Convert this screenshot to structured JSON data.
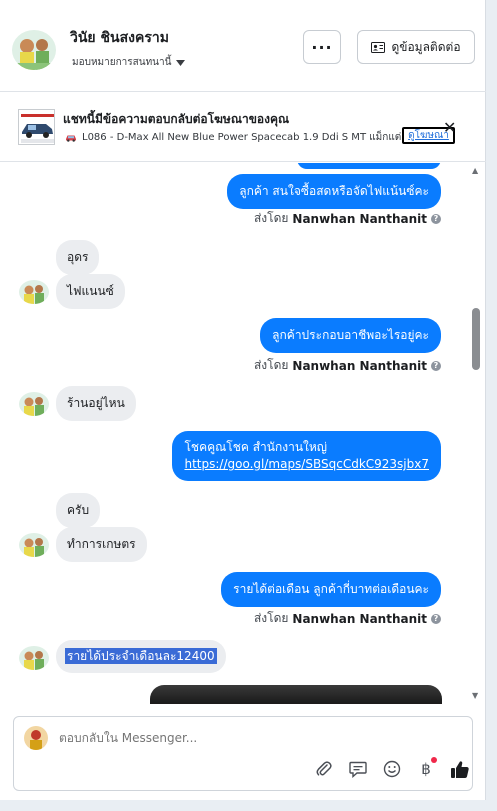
{
  "header": {
    "name": "วินัย ชินสงคราม",
    "assign_label": "มอบหมายการสนทนานี้",
    "more_label": "···",
    "contact_label": "ดูข้อมูลติดต่อ"
  },
  "banner": {
    "title": "แชทนี้มีข้อความตอบกลับต่อโฆษณาของคุณ",
    "subtitle": "L086 - D-Max All New Blue Power Spacecab 1.9 Ddi S MT แม็กแต่...",
    "link": "ดูโฆษณา",
    "close": "✕"
  },
  "messages": [
    {
      "side": "out",
      "text": "ลูกค้า สนใจซื้อสดหรือจัดไฟแน้นซ์คะ"
    },
    {
      "side": "sentby",
      "prefix": "ส่งโดย",
      "sender": "Nanwhan Nanthanit"
    },
    {
      "side": "in",
      "text": "อุดร"
    },
    {
      "side": "in",
      "text": "ไฟแนนซ์"
    },
    {
      "side": "out",
      "text": "ลูกค้าประกอบอาชีพอะไรอยู่คะ"
    },
    {
      "side": "sentby",
      "prefix": "ส่งโดย",
      "sender": "Nanwhan Nanthanit"
    },
    {
      "side": "in",
      "text": "ร้านอยู่ไหน"
    },
    {
      "side": "out",
      "text": "โชคคูณโชค สำนักงานใหญ่",
      "link": "https://goo.gl/maps/SBSqcCdkC923sjbx7"
    },
    {
      "side": "in",
      "text": "ครับ"
    },
    {
      "side": "in",
      "text": "ทำการเกษตร"
    },
    {
      "side": "out",
      "text": "รายได้ต่อเดือน  ลูกค้ากี่บาทต่อเดือนคะ"
    },
    {
      "side": "sentby",
      "prefix": "ส่งโดย",
      "sender": "Nanwhan Nanthanit"
    },
    {
      "side": "in",
      "text": "รายได้ประจำเดือนละ12400"
    }
  ],
  "composer": {
    "placeholder": "ตอบกลับใน Messenger..."
  },
  "icons": {
    "attach": "paperclip-icon",
    "saved_replies": "chat-bubble-icon",
    "emoji": "smiley-icon",
    "currency": "baht-icon",
    "like": "thumbs-up-icon"
  },
  "colors": {
    "outgoing_bubble": "#0a7cff",
    "incoming_bubble": "#ebedf0",
    "selection": "#3a6bd6"
  }
}
